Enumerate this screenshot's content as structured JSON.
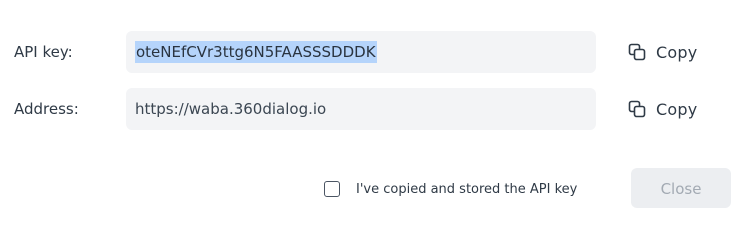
{
  "api_key": {
    "label": "API key:",
    "value": "oteNEfCVr3ttg6N5FAASSSDDDK",
    "value_selected": true,
    "copy_label": "Copy"
  },
  "address": {
    "label": "Address:",
    "value": "https://waba.360dialog.io",
    "copy_label": "Copy"
  },
  "confirm": {
    "label": "I've copied and stored the API key",
    "checked": false
  },
  "close_button": {
    "label": "Close",
    "disabled": true
  },
  "icons": {
    "copy": "copy-icon"
  },
  "colors": {
    "selection": "#b5d4fb",
    "field_bg": "#f3f4f6",
    "disabled_button_bg": "#eceef1",
    "disabled_button_text": "#a3aab3"
  }
}
